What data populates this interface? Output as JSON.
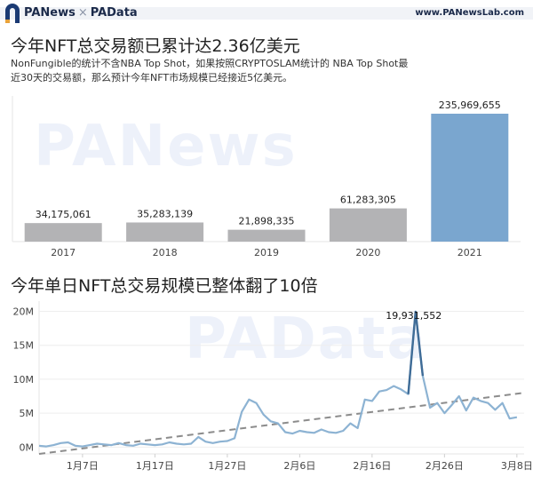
{
  "header": {
    "brand_pa": "PANews",
    "separator": "×",
    "brand_pd": "PAData",
    "url": "www.PANewsLab.com"
  },
  "watermarks": {
    "top": "PANews",
    "bottom": "PAData"
  },
  "colors": {
    "bar_gray": "#b3b3b5",
    "bar_highlight": "#7aa6cf",
    "line": "#8db3d3",
    "peak_line": "#3f6c97",
    "trend": "#8c8c8c"
  },
  "chart_data": [
    {
      "type": "bar",
      "title": "今年NFT总交易额已累计达2.36亿美元",
      "subtitle": "NonFungible的统计不含NBA Top Shot，如果按照CRYPTOSLAM统计的 NBA Top Shot最近30天的交易额，那么预计今年NFT市场规模已经接近5亿美元。",
      "categories": [
        "2017",
        "2018",
        "2019",
        "2020",
        "2021"
      ],
      "values": [
        34175061,
        35283139,
        21898335,
        61283305,
        235969655
      ],
      "labels": [
        "34,175,061",
        "35,283,139",
        "21,898,335",
        "61,283,305",
        "235,969,655"
      ],
      "highlight": "2021",
      "ylim": [
        0,
        250000000
      ],
      "grid": false
    },
    {
      "type": "line",
      "title": "今年单日NFT总交易规模已整体翻了10倍",
      "x_start": "2021-01-01",
      "x_end": "2021-03-09",
      "x_ticks": [
        "1月7日",
        "1月17日",
        "1月27日",
        "2月6日",
        "2月16日",
        "2月26日",
        "3月8日"
      ],
      "x_tick_dates": [
        "2021-01-07",
        "2021-01-17",
        "2021-01-27",
        "2021-02-06",
        "2021-02-16",
        "2021-02-26",
        "2021-03-08"
      ],
      "y_ticks": [
        "0M",
        "5M",
        "10M",
        "15M",
        "20M"
      ],
      "y_tick_values": [
        0,
        5000000,
        10000000,
        15000000,
        20000000
      ],
      "ylim": [
        -1000000,
        21500000
      ],
      "series": [
        {
          "x": [
            "2021-01-01",
            "2021-01-02",
            "2021-01-03",
            "2021-01-04",
            "2021-01-05",
            "2021-01-06",
            "2021-01-07",
            "2021-01-08",
            "2021-01-09",
            "2021-01-10",
            "2021-01-11",
            "2021-01-12",
            "2021-01-13",
            "2021-01-14",
            "2021-01-15",
            "2021-01-16",
            "2021-01-17",
            "2021-01-18",
            "2021-01-19",
            "2021-01-20",
            "2021-01-21",
            "2021-01-22",
            "2021-01-23",
            "2021-01-24",
            "2021-01-25",
            "2021-01-26",
            "2021-01-27",
            "2021-01-28",
            "2021-01-29",
            "2021-01-30",
            "2021-01-31",
            "2021-02-01",
            "2021-02-02",
            "2021-02-03",
            "2021-02-04",
            "2021-02-05",
            "2021-02-06",
            "2021-02-07",
            "2021-02-08",
            "2021-02-09",
            "2021-02-10",
            "2021-02-11",
            "2021-02-12",
            "2021-02-13",
            "2021-02-14",
            "2021-02-15",
            "2021-02-16",
            "2021-02-17",
            "2021-02-18",
            "2021-02-19",
            "2021-02-20",
            "2021-02-21",
            "2021-02-22",
            "2021-02-23",
            "2021-02-24",
            "2021-02-25",
            "2021-02-26",
            "2021-02-27",
            "2021-02-28",
            "2021-03-01",
            "2021-03-02",
            "2021-03-03",
            "2021-03-04",
            "2021-03-05",
            "2021-03-06",
            "2021-03-07",
            "2021-03-08"
          ],
          "values": [
            200000,
            100000,
            300000,
            600000,
            700000,
            200000,
            100000,
            300000,
            500000,
            400000,
            300000,
            600000,
            300000,
            200000,
            500000,
            400000,
            300000,
            400000,
            700000,
            500000,
            400000,
            500000,
            1500000,
            800000,
            600000,
            800000,
            900000,
            1300000,
            5200000,
            7000000,
            6500000,
            4800000,
            3800000,
            3500000,
            2200000,
            2000000,
            2400000,
            2200000,
            2100000,
            2600000,
            2200000,
            2100000,
            2400000,
            3500000,
            2800000,
            7000000,
            6800000,
            8200000,
            8400000,
            9000000,
            8500000,
            7800000,
            19931552,
            10500000,
            5800000,
            6500000,
            5000000,
            6200000,
            7500000,
            5400000,
            7300000,
            6800000,
            6500000,
            5500000,
            6500000,
            4200000,
            4400000
          ]
        }
      ],
      "peak": {
        "x": "2021-02-22",
        "value": 19931552,
        "label": "19,931,552"
      },
      "trend": {
        "x": [
          "2021-01-01",
          "2021-03-09"
        ],
        "values": [
          -1000000,
          8000000
        ],
        "style": "dashed"
      },
      "grid": true
    }
  ]
}
